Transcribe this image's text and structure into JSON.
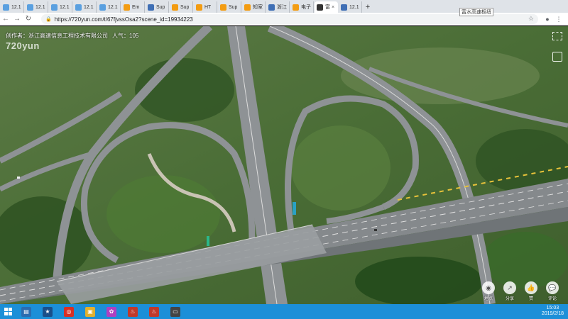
{
  "browser": {
    "tabs": [
      {
        "label": "12.1",
        "fav": "#5aa0e0"
      },
      {
        "label": "12.1",
        "fav": "#5aa0e0"
      },
      {
        "label": "12.1",
        "fav": "#5aa0e0"
      },
      {
        "label": "12.1",
        "fav": "#5aa0e0"
      },
      {
        "label": "12.1",
        "fav": "#5aa0e0"
      },
      {
        "label": "Em",
        "fav": "#f39c12"
      },
      {
        "label": "Sup",
        "fav": "#3f6fb5"
      },
      {
        "label": "Sup",
        "fav": "#f39c12"
      },
      {
        "label": "HT",
        "fav": "#f39c12"
      },
      {
        "label": "Sup",
        "fav": "#f39c12"
      },
      {
        "label": "知室",
        "fav": "#f39c12"
      },
      {
        "label": "浙江",
        "fav": "#3f6fb5"
      },
      {
        "label": "电子",
        "fav": "#f39c12"
      },
      {
        "label": "富",
        "fav": "#333333",
        "active": true
      },
      {
        "label": "12.1",
        "fav": "#3f6fb5"
      }
    ],
    "new_tab": "+",
    "tooltip": "富水高速枢纽",
    "back": "←",
    "forward": "→",
    "reload": "↻",
    "lock": "🔒",
    "url": "https://720yun.com/t/67fjvssOsa2?scene_id=19934223",
    "star": "☆",
    "profile": "●",
    "menu": "⋮"
  },
  "pano": {
    "author_line": "创作者：浙江高速信息工程技术有限公司",
    "views": "人气：105",
    "logo": "720yun",
    "actions": [
      {
        "name": "location",
        "glyph": "◉",
        "label": "地点"
      },
      {
        "name": "share",
        "glyph": "↗",
        "label": "分享"
      },
      {
        "name": "like",
        "glyph": "👍",
        "label": "赞"
      },
      {
        "name": "comment",
        "glyph": "💬",
        "label": "评论"
      }
    ]
  },
  "taskbar": {
    "apps": [
      {
        "name": "file-manager",
        "glyph": "▤",
        "color": "#2b6cb0"
      },
      {
        "name": "media",
        "glyph": "★",
        "color": "#1a4f8a"
      },
      {
        "name": "chrome",
        "glyph": "◎",
        "color": "#d93025"
      },
      {
        "name": "explorer",
        "glyph": "▣",
        "color": "#e0b030"
      },
      {
        "name": "photos",
        "glyph": "✿",
        "color": "#b040c0"
      },
      {
        "name": "java",
        "glyph": "♨",
        "color": "#c0392b"
      },
      {
        "name": "java2",
        "glyph": "♨",
        "color": "#c0392b"
      },
      {
        "name": "monitor",
        "glyph": "▭",
        "color": "#444444"
      }
    ],
    "time": "15:03",
    "date": "2019/2/18"
  }
}
